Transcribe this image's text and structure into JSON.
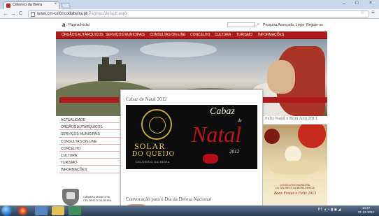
{
  "browser": {
    "tab_title": "Cèlorico da Beira",
    "tab_close": "×",
    "url_host": "www.cm-celoricodabeira.pt",
    "url_path": "/Paginas/default.aspx",
    "back": "←",
    "forward": "→",
    "reload": "C",
    "min": "–",
    "max": "□",
    "close": "×",
    "star": "☆",
    "menu": "≡"
  },
  "toplinks": {
    "home_icon": "a",
    "home_label": "Página Inicial",
    "search_go": "»",
    "advanced_search": "Pesquisa Avançada",
    "login": "Login",
    "register": "Registe-se"
  },
  "menu": {
    "items": [
      "ÓRGÃOS AUTÁRQUICOS",
      "SERVIÇOS MUNICIPAIS",
      "CONSULTAS ON-LINE",
      "CONCELHO",
      "CULTURA",
      "TURISMO",
      "INFORMAÇÕES"
    ]
  },
  "sidenav": {
    "items": [
      "ACTUALIDADE",
      "ÓRGÃOS AUTÁRQUICOS",
      "SERVIÇOS MUNICIPAIS",
      "CONSULTAS ON-LINE",
      "CONCELHO",
      "CULTURA",
      "TURISMO",
      "INFORMAÇÕES"
    ]
  },
  "logo": {
    "line1": "CÂMARA MUNICIPAL",
    "line2": "CELORICO DA BEIRA"
  },
  "content": {
    "section1_title": "Cabaz de Natal 2012",
    "promo_solar": "SOLAR",
    "promo_queijo": "DO QUEIJO",
    "promo_sub": "CELORICO DA BEIRA",
    "promo_cabaz": "Cabaz",
    "promo_de": "de",
    "promo_natal": "Natal",
    "promo_year": "2012",
    "section2_title": "Convocação para o Dia da Defesa Nacional"
  },
  "rightcol": {
    "title": "Feliz Natal e Bom Ano 2013",
    "card_line1": "O EXECUTIVO MUNICIPAL",
    "card_line2": "DE CELORICO DA BEIRA DESEJA",
    "card_greeting": "Boas Festas e Feliz 2013"
  },
  "taskbar": {
    "tray_text": "PT ▲ ◐ ▮ ◉ ◢",
    "time": "18:27",
    "date": "21-12-2012"
  },
  "colors": {
    "brand_red": "#b11a1a",
    "taskbar": "#2d3e57"
  }
}
